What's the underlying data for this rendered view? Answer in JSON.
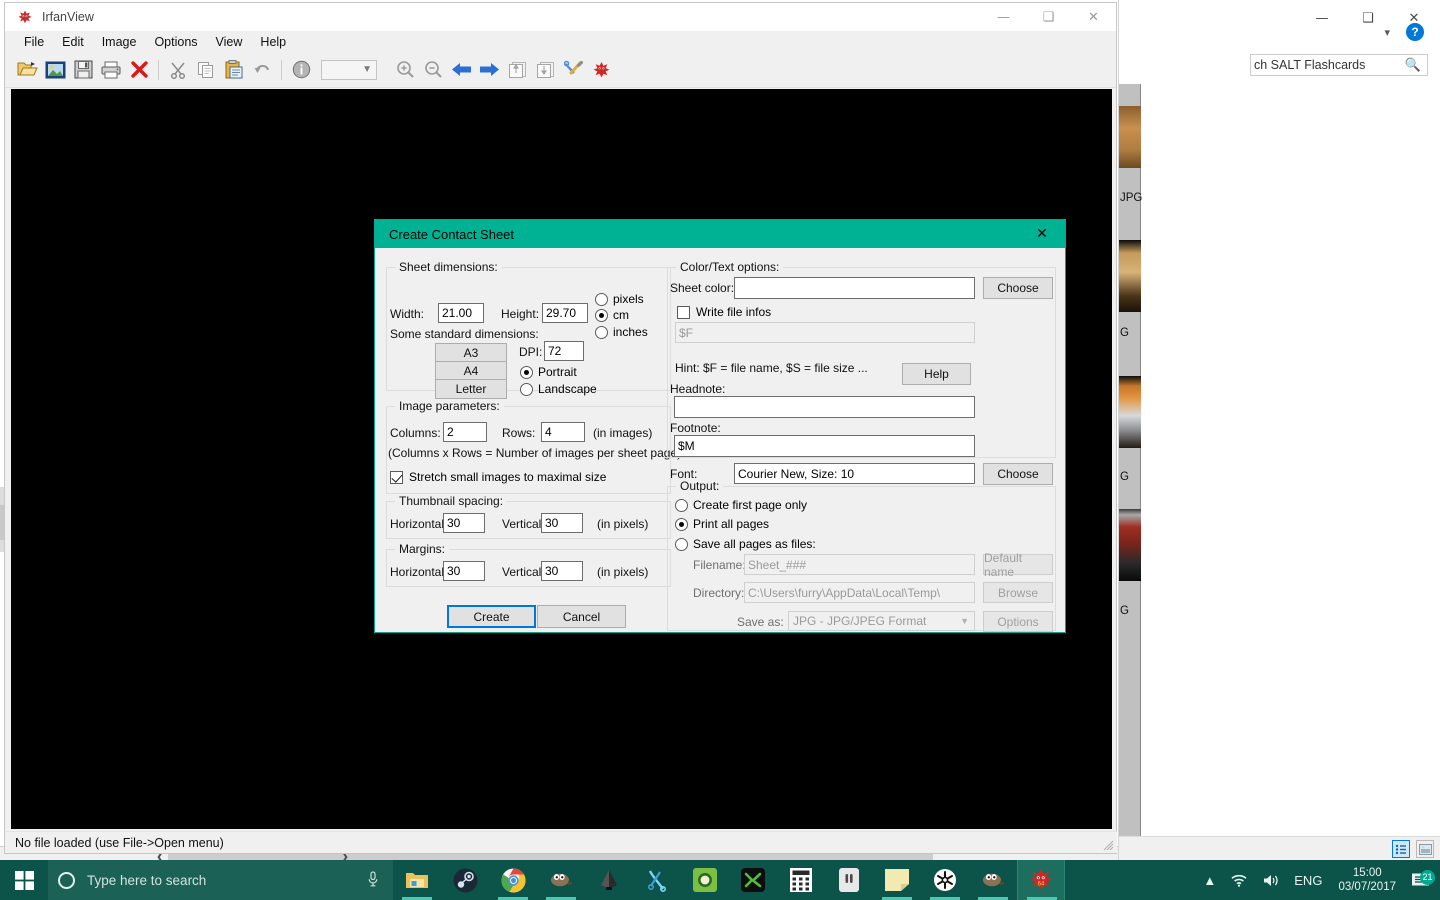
{
  "desktop": {
    "background_color": "#ffffff"
  },
  "background_explorer": {
    "search_placeholder": "ch SALT Flashcards",
    "search_icon": "search-icon",
    "help_icon": "help-circle-icon",
    "window_controls": [
      "minimize-icon",
      "maximize-icon",
      "close-icon"
    ],
    "ribbon_chevron_icon": "chevron-down-icon",
    "view_buttons": [
      "details-view-icon",
      "large-icons-view-icon"
    ],
    "file_labels": [
      "JPG",
      "G",
      "G",
      "G"
    ]
  },
  "irfanview": {
    "title": "IrfanView",
    "logo_icon": "irfanview-crab-icon",
    "window_controls": [
      "minimize-icon",
      "maximize-icon",
      "close-icon"
    ],
    "menu": [
      {
        "label": "File"
      },
      {
        "label": "Edit"
      },
      {
        "label": "Image"
      },
      {
        "label": "Options"
      },
      {
        "label": "View"
      },
      {
        "label": "Help"
      }
    ],
    "toolbar": [
      {
        "icon": "open-folder-icon"
      },
      {
        "icon": "thumbnails-icon"
      },
      {
        "icon": "save-icon"
      },
      {
        "icon": "print-icon"
      },
      {
        "icon": "delete-icon"
      },
      {
        "icon": "cut-icon"
      },
      {
        "icon": "copy-icon"
      },
      {
        "icon": "paste-icon"
      },
      {
        "icon": "undo-icon"
      },
      {
        "icon": "info-icon"
      },
      {
        "icon": "zoom-in-icon"
      },
      {
        "icon": "zoom-out-icon"
      },
      {
        "icon": "previous-arrow-icon"
      },
      {
        "icon": "next-arrow-icon"
      },
      {
        "icon": "first-page-icon"
      },
      {
        "icon": "last-page-icon"
      },
      {
        "icon": "settings-tools-icon"
      },
      {
        "icon": "irfanview-crab-icon"
      }
    ],
    "zoom_combo_value": "",
    "status_text": "No file loaded (use File->Open menu)"
  },
  "dialog": {
    "title": "Create Contact Sheet",
    "close_icon": "close-icon",
    "title_bar_color": "#00b294",
    "sheet_dimensions": {
      "legend": "Sheet dimensions:",
      "width_label": "Width:",
      "width_value": "21.00",
      "height_label": "Height:",
      "height_value": "29.70",
      "standard_label": "Some standard dimensions:",
      "standard_buttons": [
        "A3",
        "A4",
        "Letter"
      ],
      "dpi_label": "DPI:",
      "dpi_value": "72",
      "units": [
        {
          "label": "pixels",
          "selected": false
        },
        {
          "label": "cm",
          "selected": true
        },
        {
          "label": "inches",
          "selected": false
        }
      ],
      "orientation": [
        {
          "label": "Portrait",
          "selected": true
        },
        {
          "label": "Landscape",
          "selected": false
        }
      ]
    },
    "image_parameters": {
      "legend": "Image parameters:",
      "columns_label": "Columns:",
      "columns_value": "2",
      "rows_label": "Rows:",
      "rows_value": "4",
      "in_images_label": "(in images)",
      "hint": "(Columns x Rows = Number of images per sheet page)",
      "stretch_label": "Stretch small images to maximal size",
      "stretch_checked": true,
      "thumbnail_spacing_legend": "Thumbnail spacing:",
      "spacing_horizontal_label": "Horizontal:",
      "spacing_horizontal_value": "30",
      "spacing_vertical_label": "Vertical:",
      "spacing_vertical_value": "30",
      "spacing_units": "(in pixels)",
      "margins_legend": "Margins:",
      "margins_horizontal_label": "Horizontal:",
      "margins_horizontal_value": "30",
      "margins_vertical_label": "Vertical:",
      "margins_vertical_value": "30",
      "margins_units": "(in pixels)"
    },
    "actions": {
      "create_label": "Create",
      "cancel_label": "Cancel"
    },
    "color_text_options": {
      "legend": "Color/Text options:",
      "sheet_color_label": "Sheet color:",
      "sheet_color_value": "",
      "sheet_color_choose": "Choose",
      "write_file_infos_label": "Write file infos",
      "write_file_infos_checked": false,
      "file_info_value": "$F",
      "hint": "Hint: $F = file name, $S = file size ...",
      "help_label": "Help",
      "headnote_label": "Headnote:",
      "headnote_value": "",
      "footnote_label": "Footnote:",
      "footnote_value": "$M",
      "font_label": "Font:",
      "font_value": "Courier New, Size: 10",
      "font_choose": "Choose"
    },
    "output": {
      "legend": "Output:",
      "options": [
        {
          "label": "Create first page only",
          "selected": false
        },
        {
          "label": "Print all pages",
          "selected": true
        },
        {
          "label": "Save all pages as files:",
          "selected": false
        }
      ],
      "filename_label": "Filename:",
      "filename_value": "Sheet_###",
      "default_name_button": "Default name",
      "directory_label": "Directory:",
      "directory_value": "C:\\Users\\furry\\AppData\\Local\\Temp\\",
      "browse_button": "Browse",
      "save_as_label": "Save as:",
      "save_as_value": "JPG - JPG/JPEG Format",
      "options_button": "Options"
    }
  },
  "taskbar": {
    "background_color": "#0c5449",
    "start_icon": "windows-start-icon",
    "search_placeholder": "Type here to search",
    "cortana_icon": "cortana-circle-icon",
    "mic_icon": "microphone-icon",
    "apps": [
      {
        "name": "file-explorer",
        "running": true
      },
      {
        "name": "steam",
        "running": false
      },
      {
        "name": "google-chrome",
        "running": true
      },
      {
        "name": "gimp",
        "running": true
      },
      {
        "name": "inkscape",
        "running": false
      },
      {
        "name": "blue-scissors-app",
        "running": false
      },
      {
        "name": "green-app",
        "running": false
      },
      {
        "name": "green-x-app",
        "running": false
      },
      {
        "name": "calculator",
        "running": false
      },
      {
        "name": "white-device-app",
        "running": false
      },
      {
        "name": "sticky-notes",
        "running": true
      },
      {
        "name": "snowflake-app",
        "running": true
      },
      {
        "name": "gimp-2",
        "running": true
      },
      {
        "name": "irfanview",
        "running": true,
        "active": true
      }
    ],
    "tray": {
      "chevron_icon": "show-hidden-icons-chevron",
      "wifi_icon": "wifi-icon",
      "volume_icon": "volume-icon",
      "language": "ENG",
      "time": "15:00",
      "date": "03/07/2017",
      "notification_icon": "action-center-icon",
      "notification_count": "21"
    }
  }
}
